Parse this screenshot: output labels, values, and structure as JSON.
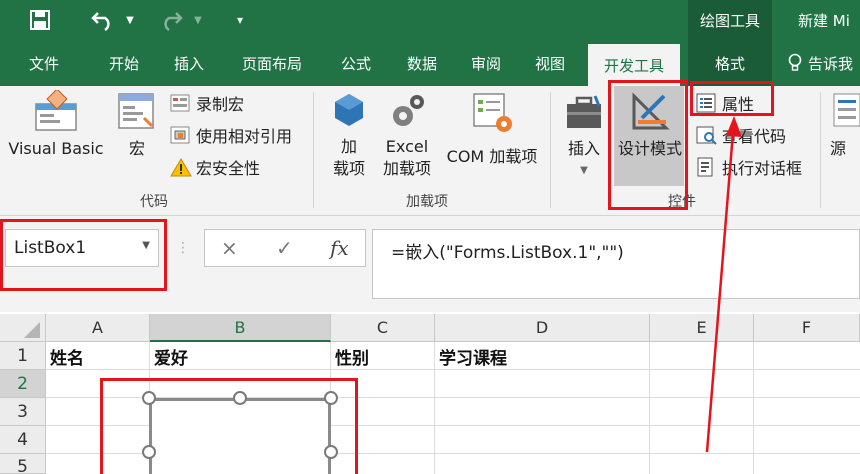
{
  "title_bar": {
    "undo_icon": "undo-icon",
    "redo_icon": "redo-icon",
    "context_group": "绘图工具",
    "window_title": "新建 Mi"
  },
  "tabs": [
    "文件",
    "开始",
    "插入",
    "页面布局",
    "公式",
    "数据",
    "审阅",
    "视图",
    "开发工具",
    "格式"
  ],
  "active_tab": "开发工具",
  "tell_me": "告诉我",
  "ribbon": {
    "code": {
      "label": "代码",
      "visual_basic": "Visual Basic",
      "macros": "宏",
      "record_macro": "录制宏",
      "use_relative": "使用相对引用",
      "macro_security": "宏安全性"
    },
    "addins": {
      "label": "加载项",
      "addins_line1": "加",
      "addins_line2": "载项",
      "excel_line1": "Excel",
      "excel_line2": "加载项",
      "com": "COM 加载项"
    },
    "controls": {
      "label": "控件",
      "insert": "插入",
      "design_mode": "设计模式",
      "properties": "属性",
      "view_code": "查看代码",
      "run_dialog": "执行对话框"
    },
    "source": "源"
  },
  "formula_bar": {
    "name_box": "ListBox1",
    "cancel_icon": "×",
    "enter_icon": "✓",
    "fx": "fx",
    "formula": "=嵌入(\"Forms.ListBox.1\",\"\")"
  },
  "sheet": {
    "columns": [
      "A",
      "B",
      "C",
      "D",
      "E",
      "F"
    ],
    "selected_column": "B",
    "rows": [
      "1",
      "2",
      "3",
      "4",
      "5"
    ],
    "selected_row": "2",
    "row1": [
      "姓名",
      "爱好",
      "性别",
      "学习课程"
    ]
  },
  "colors": {
    "excel_green": "#217346",
    "annotation_red": "#e5141c"
  }
}
